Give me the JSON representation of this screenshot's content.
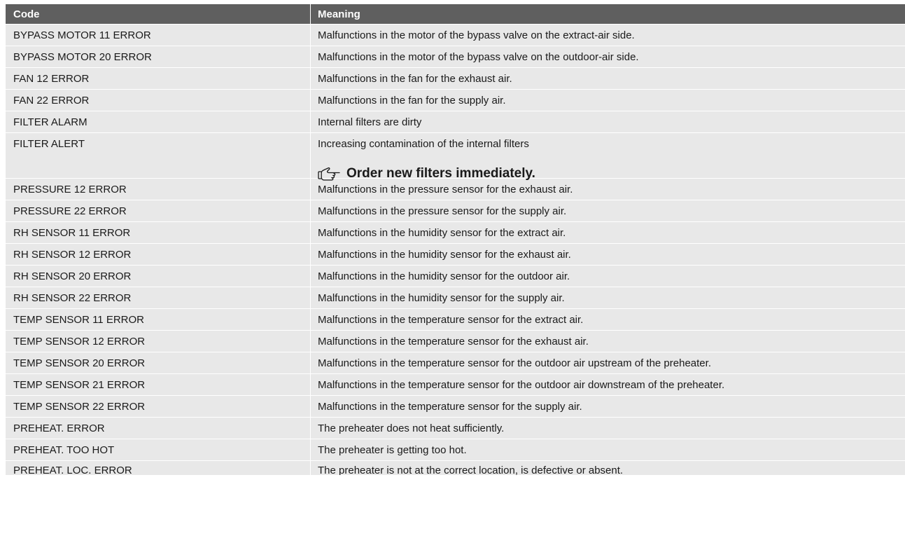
{
  "table": {
    "headers": {
      "code": "Code",
      "meaning": "Meaning"
    },
    "rows": [
      {
        "code": "BYPASS MOTOR 11 ERROR",
        "meaning": "Malfunctions in the motor of the bypass valve on the extract-air side."
      },
      {
        "code": "BYPASS MOTOR 20 ERROR",
        "meaning": "Malfunctions in the motor of the bypass valve on the outdoor-air side."
      },
      {
        "code": "FAN 12 ERROR",
        "meaning": "Malfunctions in the fan for the exhaust air."
      },
      {
        "code": "FAN 22 ERROR",
        "meaning": "Malfunctions in the fan for the supply air."
      },
      {
        "code": "FILTER ALARM",
        "meaning": "Internal filters are dirty"
      },
      {
        "code": "FILTER ALERT",
        "meaning": "Increasing contamination of the internal filters",
        "note": "Order new filters immediately.",
        "note_icon": "pointing-hand-icon"
      },
      {
        "code": "PRESSURE 12 ERROR",
        "meaning": "Malfunctions in the pressure sensor for the exhaust air."
      },
      {
        "code": "PRESSURE 22 ERROR",
        "meaning": "Malfunctions in the pressure sensor for the supply air."
      },
      {
        "code": "RH SENSOR 11 ERROR",
        "meaning": "Malfunctions in the humidity sensor for the extract air."
      },
      {
        "code": "RH SENSOR 12 ERROR",
        "meaning": "Malfunctions in the humidity sensor for the exhaust air."
      },
      {
        "code": "RH SENSOR 20 ERROR",
        "meaning": "Malfunctions in the humidity sensor for the outdoor air."
      },
      {
        "code": "RH SENSOR 22 ERROR",
        "meaning": "Malfunctions in the humidity sensor for the supply air."
      },
      {
        "code": "TEMP SENSOR 11 ERROR",
        "meaning": "Malfunctions in the temperature sensor for the extract air."
      },
      {
        "code": "TEMP SENSOR 12 ERROR",
        "meaning": "Malfunctions in the temperature sensor for the exhaust air."
      },
      {
        "code": "TEMP SENSOR 20 ERROR",
        "meaning": "Malfunctions in the temperature sensor for the outdoor air upstream of the preheater."
      },
      {
        "code": "TEMP SENSOR 21 ERROR",
        "meaning": "Malfunctions in the temperature sensor for the outdoor air downstream of the preheater."
      },
      {
        "code": "TEMP SENSOR 22 ERROR",
        "meaning": "Malfunctions in the temperature sensor for the supply air."
      },
      {
        "code": "PREHEAT. ERROR",
        "meaning": "The preheater does not heat sufficiently."
      },
      {
        "code": "PREHEAT. TOO HOT",
        "meaning": "The preheater is getting too hot."
      },
      {
        "code": "PREHEAT. LOC. ERROR",
        "meaning": "The preheater is not at the correct location, is defective or absent."
      }
    ]
  },
  "colors": {
    "header_bg": "#5f5f5f",
    "row_bg": "#e8e8e8",
    "text": "#1a1a1a"
  }
}
